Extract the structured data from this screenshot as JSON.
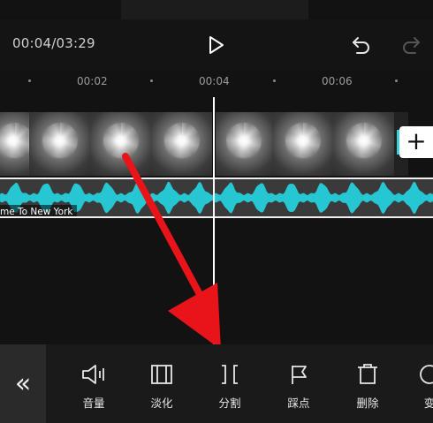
{
  "header": {
    "timecode": "00:04/03:29",
    "play_icon": "play-icon",
    "undo_icon": "undo-icon",
    "redo_icon": "redo-icon"
  },
  "ruler": {
    "labels": [
      "00:02",
      "00:04",
      "00:06"
    ]
  },
  "timeline": {
    "audio_clip_title": "me To New York",
    "add_clip_symbol": "+",
    "waveform_color": "#26c6d2",
    "playhead_color": "#ffffff"
  },
  "annotation": {
    "arrow_color": "#e8141a"
  },
  "toolbar": {
    "collapse_symbol": "«",
    "tools": [
      {
        "label": "音量",
        "icon": "volume-icon"
      },
      {
        "label": "淡化",
        "icon": "fade-icon"
      },
      {
        "label": "分割",
        "icon": "split-icon"
      },
      {
        "label": "踩点",
        "icon": "beat-flag-icon"
      },
      {
        "label": "删除",
        "icon": "delete-icon"
      },
      {
        "label": "变",
        "icon": "speed-icon"
      }
    ]
  }
}
